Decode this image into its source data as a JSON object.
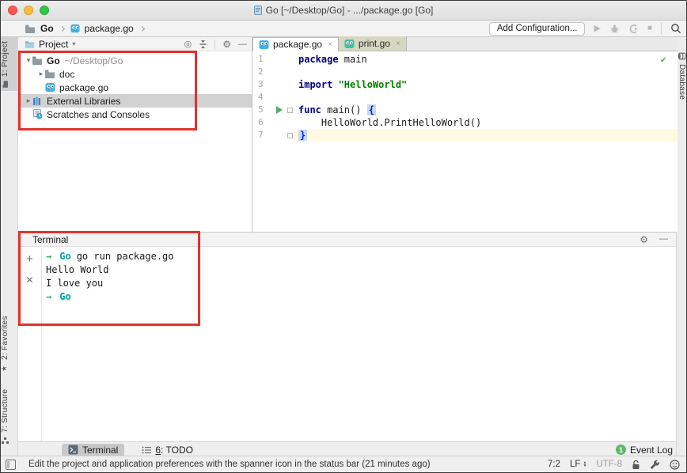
{
  "window": {
    "title": "Go [~/Desktop/Go] - .../package.go [Go]"
  },
  "navbar": {
    "crumb_project": "Go",
    "crumb_file": "package.go",
    "add_configuration": "Add Configuration..."
  },
  "left_stripe": {
    "project_tab": "1: Project",
    "favorites_tab": "2: Favorites",
    "structure_tab": "7: Structure"
  },
  "right_stripe": {
    "database_tab": "Database"
  },
  "project_panel": {
    "title": "Project",
    "tree": [
      {
        "label": "Go",
        "path": "~/Desktop/Go"
      },
      {
        "label": "doc"
      },
      {
        "label": "package.go"
      },
      {
        "label": "External Libraries"
      },
      {
        "label": "Scratches and Consoles"
      }
    ]
  },
  "editor": {
    "tab1": "package.go",
    "tab2": "print.go",
    "line_numbers": [
      "1",
      "2",
      "3",
      "4",
      "5",
      "6",
      "7"
    ],
    "code": {
      "l1_keyword": "package",
      "l1_text": " main",
      "l3_keyword": "import",
      "l3_string": " \"HelloWorld\"",
      "l5_keyword": "func",
      "l5_text": " main() ",
      "l5_brace": "{",
      "l6_text": "    HelloWorld.PrintHelloWorld()",
      "l7_brace": "}"
    }
  },
  "terminal": {
    "title": "Terminal",
    "prompt_arrow": "→",
    "prompt_dir": "Go",
    "command": "go run package.go",
    "output_line1": "Hello World",
    "output_line2": "I love you"
  },
  "bottom_bar": {
    "terminal_tab": "Terminal",
    "todo_tab_num": "6",
    "todo_tab_rest": ": TODO",
    "event_log": "Event Log",
    "event_log_badge": "1"
  },
  "status_bar": {
    "message": "Edit the project and application preferences with the spanner icon in the status bar (21 minutes ago)",
    "caret_position": "7:2",
    "line_separator": "LF",
    "encoding": "UTF-8"
  },
  "icons": {
    "gear": "⚙",
    "minimize": "—",
    "plus": "+",
    "close": "✕",
    "tab_close": "×",
    "chevron_down": "▾",
    "chevron_right": "▸",
    "locate": "◎",
    "check": "✔",
    "star": "★",
    "play": "▶",
    "stop": "■",
    "up": "▲",
    "down": "▼"
  },
  "colors": {
    "annotation": "#e0332e",
    "run_green": "#59a869",
    "terminal_dir": "#00a0a0",
    "terminal_arrow": "#35b558"
  }
}
